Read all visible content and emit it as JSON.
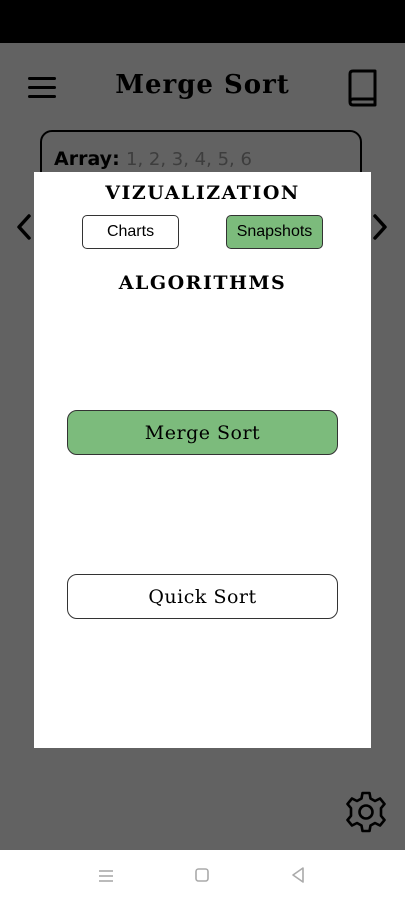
{
  "header": {
    "title": "Merge Sort",
    "menu_icon": "hamburger-menu-icon",
    "book_icon": "book-icon"
  },
  "array_input": {
    "label": "Array:",
    "value": "1, 2, 3, 4, 5, 6"
  },
  "modal": {
    "visualization_title": "VIZUALIZATION",
    "visualization_options": [
      "Charts",
      "Snapshots"
    ],
    "selected_visualization": "Snapshots",
    "algorithms_title": "ALGORITHMS",
    "algorithms": [
      "Merge Sort",
      "Quick Sort"
    ],
    "selected_algorithm": "Merge Sort"
  },
  "colors": {
    "selected": "#7cbb7c",
    "overlay": "#626262"
  },
  "system_nav": [
    "menu-icon",
    "home-square-icon",
    "back-triangle-icon"
  ]
}
